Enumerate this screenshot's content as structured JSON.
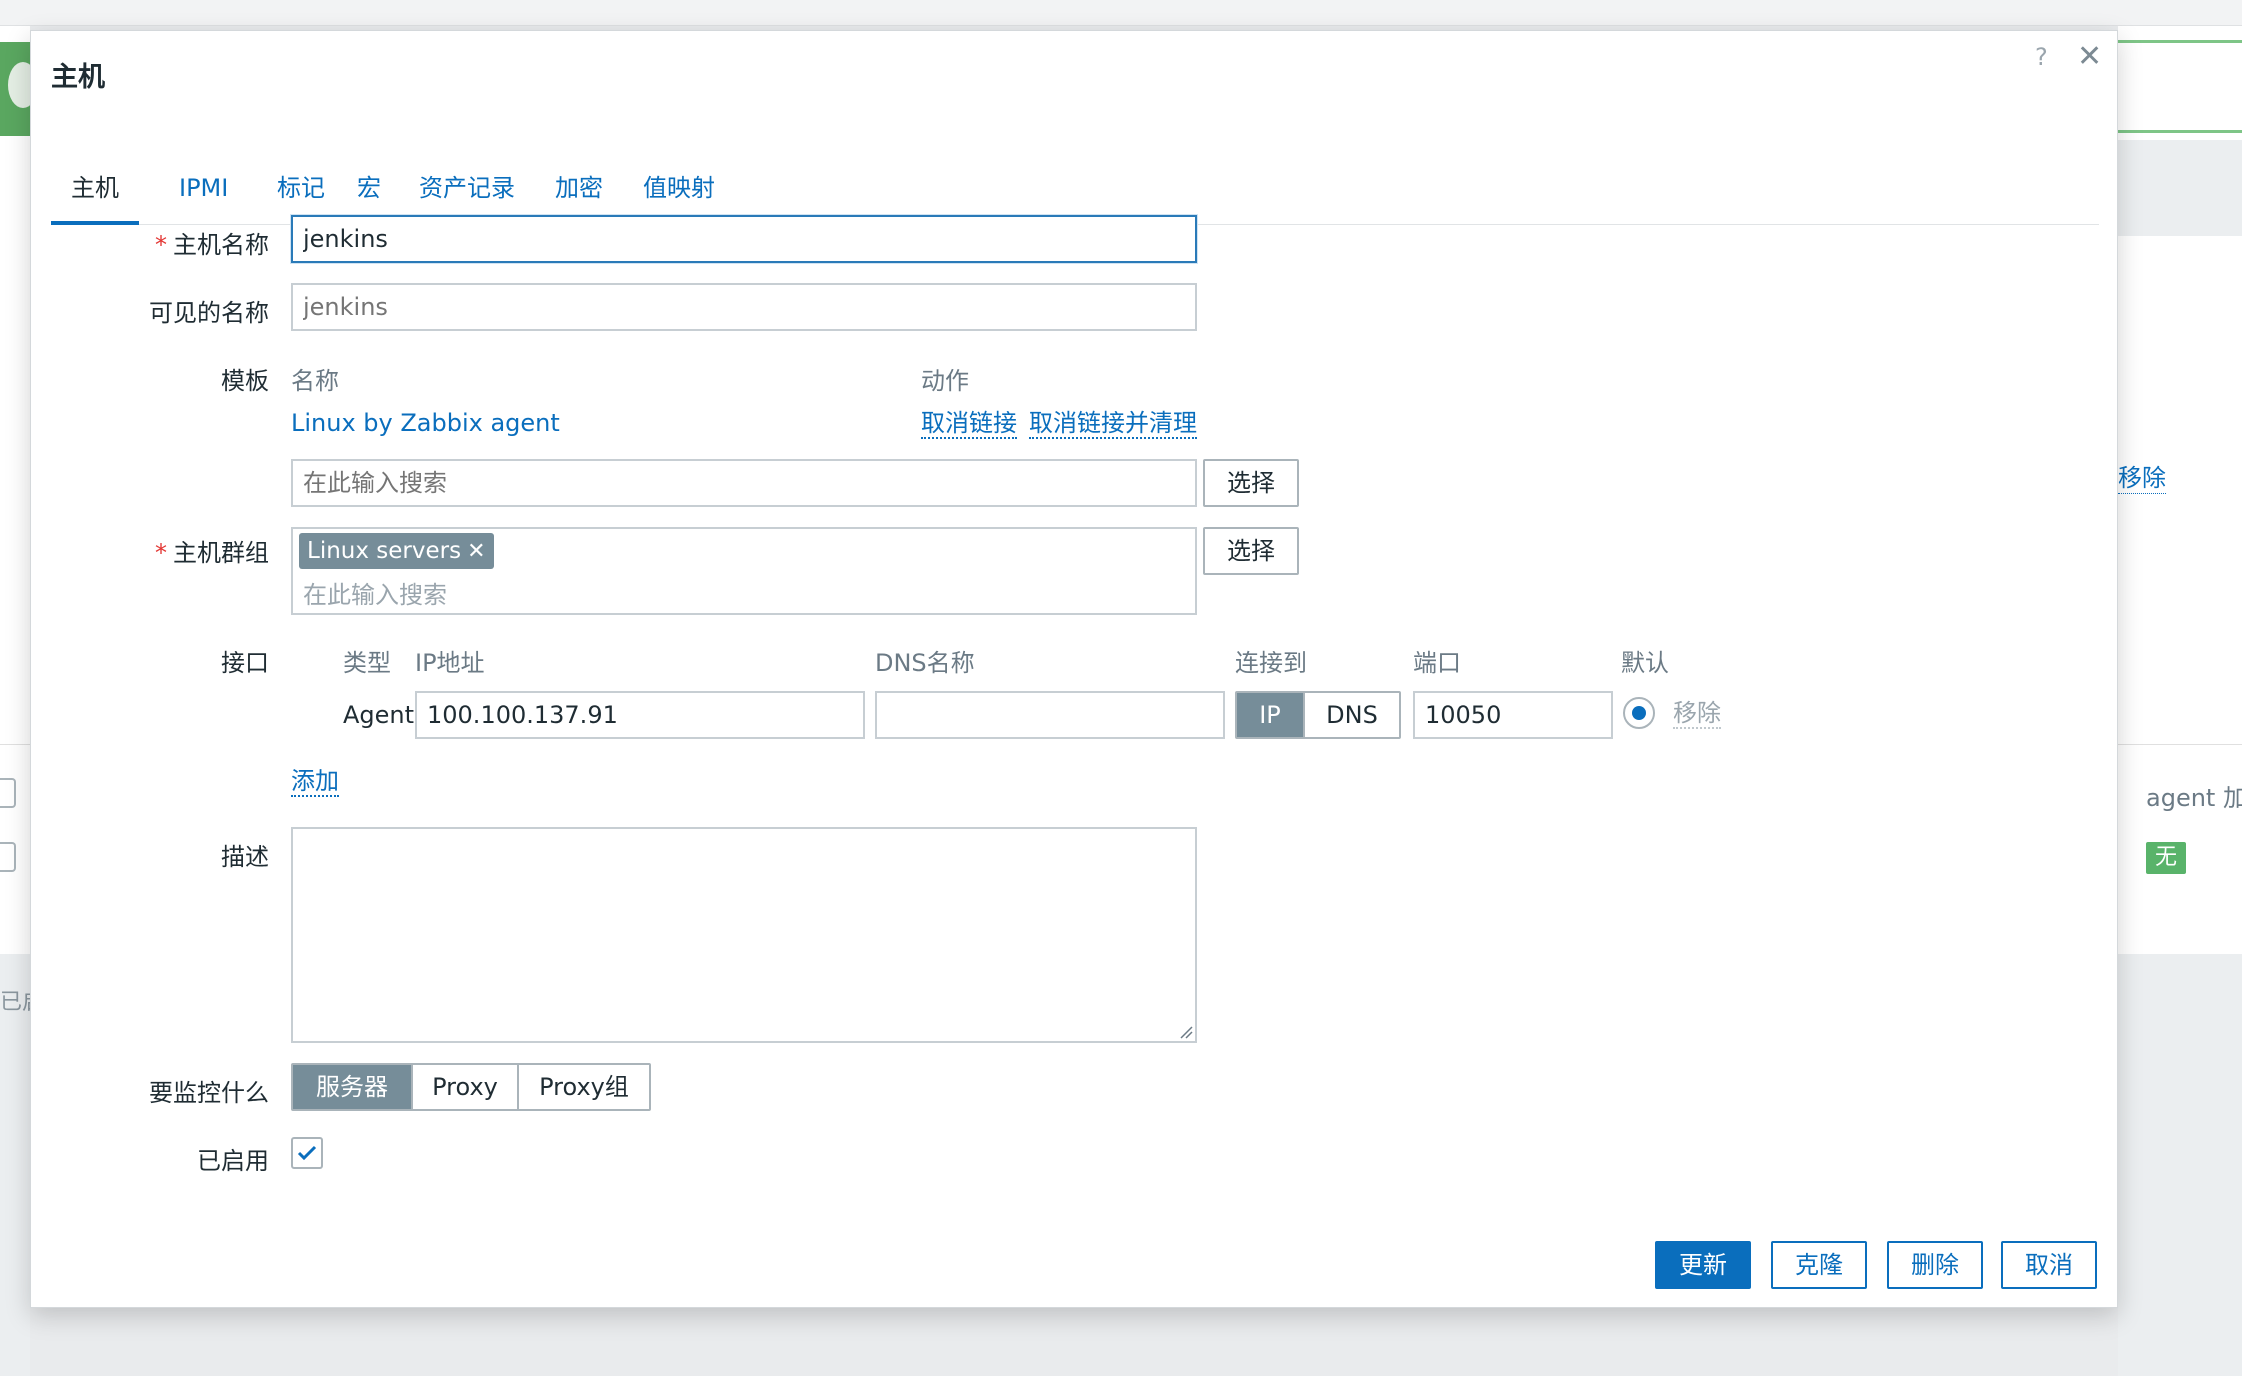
{
  "background": {
    "remove_link": "移除",
    "agent_col": "agent 加密",
    "status_badge": "无",
    "left_text": "已启"
  },
  "dialog": {
    "title": "主机",
    "help": "?",
    "close": "✕"
  },
  "tabs": [
    "主机",
    "IPMI",
    "标记",
    "宏",
    "资产记录",
    "加密",
    "值映射"
  ],
  "form": {
    "host_name_label": "主机名称",
    "host_name_value": "jenkins",
    "visible_name_label": "可见的名称",
    "visible_name_placeholder": "jenkins",
    "templates_label": "模板",
    "templates_col_name": "名称",
    "templates_col_action": "动作",
    "template_name": "Linux by Zabbix agent",
    "template_unlink": "取消链接",
    "template_unlink_clear": "取消链接并清理",
    "template_search_placeholder": "在此输入搜索",
    "select_label": "选择",
    "host_groups_label": "主机群组",
    "host_group_chip": "Linux servers",
    "host_group_search_placeholder": "在此输入搜索",
    "interfaces_label": "接口",
    "iface_col_type": "类型",
    "iface_col_ip": "IP地址",
    "iface_col_dns": "DNS名称",
    "iface_col_connect": "连接到",
    "iface_col_port": "端口",
    "iface_col_default": "默认",
    "iface_type": "Agent",
    "iface_ip": "100.100.137.91",
    "iface_dns": "",
    "iface_connect_ip": "IP",
    "iface_connect_dns": "DNS",
    "iface_port": "10050",
    "iface_remove": "移除",
    "add_link": "添加",
    "description_label": "描述",
    "description_value": "",
    "monitored_by_label": "要监控什么",
    "monitored_by_options": [
      "服务器",
      "Proxy",
      "Proxy组"
    ],
    "enabled_label": "已启用",
    "enabled": true
  },
  "buttons": {
    "update": "更新",
    "clone": "克隆",
    "delete": "删除",
    "cancel": "取消"
  },
  "colors": {
    "accent": "#0a6ebd",
    "segment_active": "#768d99",
    "required": "#e33734"
  }
}
